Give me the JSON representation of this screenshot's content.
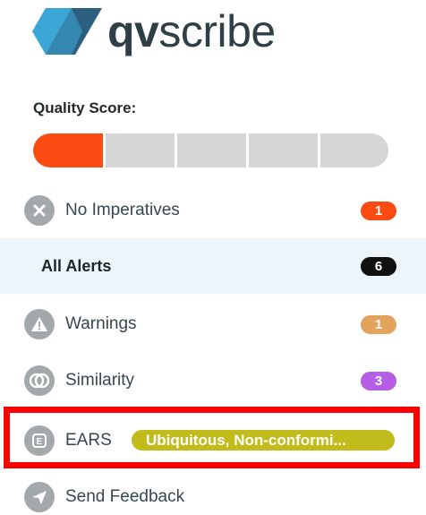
{
  "brand": {
    "name_bold": "qv",
    "name_regular": "scribe",
    "mark_colors": [
      "#3ba7d6",
      "#2d5f80"
    ]
  },
  "quality_score": {
    "label": "Quality Score:",
    "segments_total": 5,
    "segments_filled": 1,
    "fill_color": "#fb4a12"
  },
  "rules": [
    {
      "label": "No Imperatives",
      "count": "1",
      "icon": "x-circle-icon",
      "badge_color": "#fb4a12"
    }
  ],
  "alerts": {
    "all": {
      "label": "All Alerts",
      "count": "6",
      "badge_color": "#111111"
    },
    "warnings": {
      "label": "Warnings",
      "count": "1",
      "icon": "warning-icon",
      "badge_color": "#e3a35c"
    },
    "similarity": {
      "label": "Similarity",
      "count": "3",
      "icon": "similarity-icon",
      "badge_color": "#b65ee6"
    },
    "ears": {
      "label": "EARS",
      "icon": "ears-icon",
      "pill_text": "Ubiquitous, Non-conformi...",
      "pill_color": "#c1bc1b",
      "highlight_color": "#ff0000"
    }
  },
  "feedback": {
    "label": "Send Feedback",
    "icon": "send-icon"
  }
}
